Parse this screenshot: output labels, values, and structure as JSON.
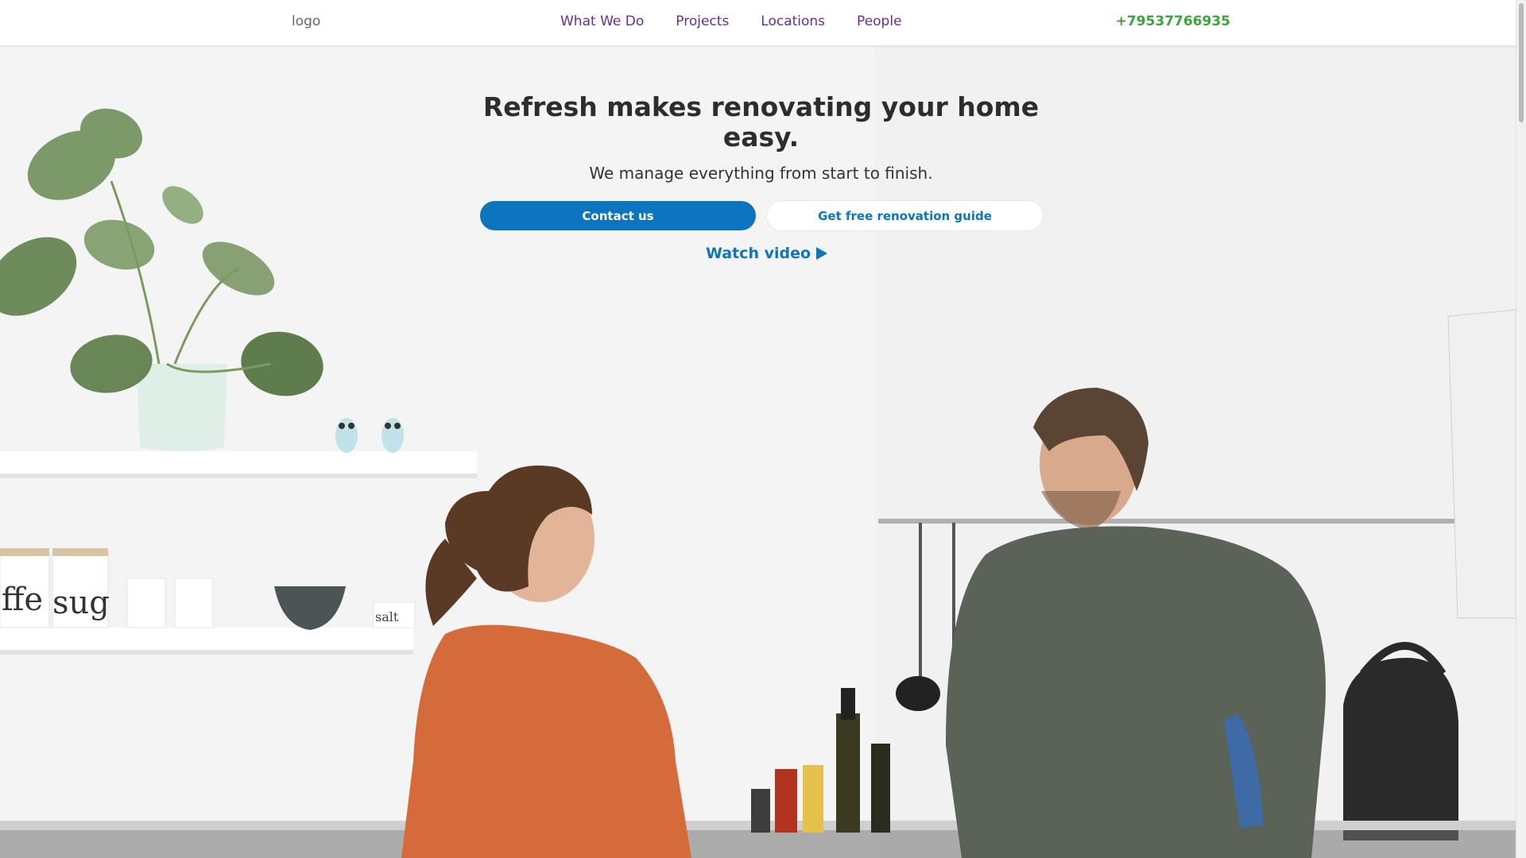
{
  "header": {
    "logo": "logo",
    "nav": [
      {
        "label": "What We Do"
      },
      {
        "label": "Projects"
      },
      {
        "label": "Locations"
      },
      {
        "label": "People"
      }
    ],
    "phone": "+79537766935"
  },
  "hero": {
    "title": "Refresh makes renovating your home easy.",
    "subtitle": "We manage everything from start to finish.",
    "primary_button": "Contact us",
    "secondary_button": "Get free renovation guide",
    "watch_video": "Watch video",
    "jar_labels": [
      "ffe",
      "sug",
      "salt"
    ]
  },
  "colors": {
    "accent": "#0d74c0",
    "nav_link": "#6b2c91",
    "phone": "#3aa53a"
  }
}
